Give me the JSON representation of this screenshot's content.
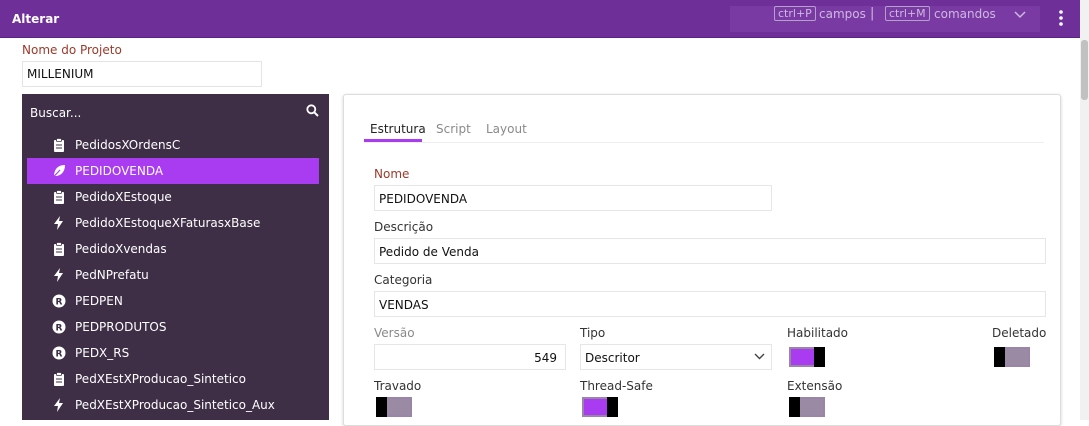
{
  "window": {
    "title": "Alterar"
  },
  "shortcuts": [
    {
      "key": "ctrl+P",
      "label": "campos"
    },
    {
      "key": "ctrl+M",
      "label": "comandos"
    }
  ],
  "project": {
    "label": "Nome do Projeto",
    "value": "MILLENIUM"
  },
  "sidebar": {
    "search_label": "Buscar...",
    "items": [
      {
        "label": "PedidosXOrdensC",
        "icon": "clipboard-icon",
        "active": false
      },
      {
        "label": "PEDIDOVENDA",
        "icon": "leaf-icon",
        "active": true
      },
      {
        "label": "PedidoXEstoque",
        "icon": "clipboard-icon",
        "active": false
      },
      {
        "label": "PedidoXEstoqueXFaturasxBase",
        "icon": "bolt-icon",
        "active": false
      },
      {
        "label": "PedidoXvendas",
        "icon": "clipboard-icon",
        "active": false
      },
      {
        "label": "PedNPrefatu",
        "icon": "bolt-icon",
        "active": false
      },
      {
        "label": "PEDPEN",
        "icon": "r-badge-icon",
        "active": false
      },
      {
        "label": "PEDPRODUTOS",
        "icon": "r-badge-icon",
        "active": false
      },
      {
        "label": "PEDX_RS",
        "icon": "r-badge-icon",
        "active": false
      },
      {
        "label": "PedXEstXProducao_Sintetico",
        "icon": "clipboard-icon",
        "active": false
      },
      {
        "label": "PedXEstXProducao_Sintetico_Aux",
        "icon": "bolt-icon",
        "active": false
      }
    ]
  },
  "tabs": [
    {
      "label": "Estrutura",
      "active": true
    },
    {
      "label": "Script",
      "active": false
    },
    {
      "label": "Layout",
      "active": false
    }
  ],
  "form": {
    "nome": {
      "label": "Nome",
      "value": "PEDIDOVENDA"
    },
    "descricao": {
      "label": "Descrição",
      "value": "Pedido de Venda"
    },
    "categoria": {
      "label": "Categoria",
      "value": "VENDAS"
    },
    "versao": {
      "label": "Versão",
      "value": "549"
    },
    "tipo": {
      "label": "Tipo",
      "value": "Descritor"
    },
    "habilitado": {
      "label": "Habilitado",
      "on": true
    },
    "deletado": {
      "label": "Deletado",
      "on": false
    },
    "travado": {
      "label": "Travado",
      "on": false
    },
    "thread_safe": {
      "label": "Thread-Safe",
      "on": true
    },
    "extensao": {
      "label": "Extensão",
      "on": false
    }
  },
  "colors": {
    "titlebar": "#6f2f99",
    "accent": "#a93cf0",
    "sidebar": "#3e2f47",
    "required_label": "#9b3a2a"
  }
}
